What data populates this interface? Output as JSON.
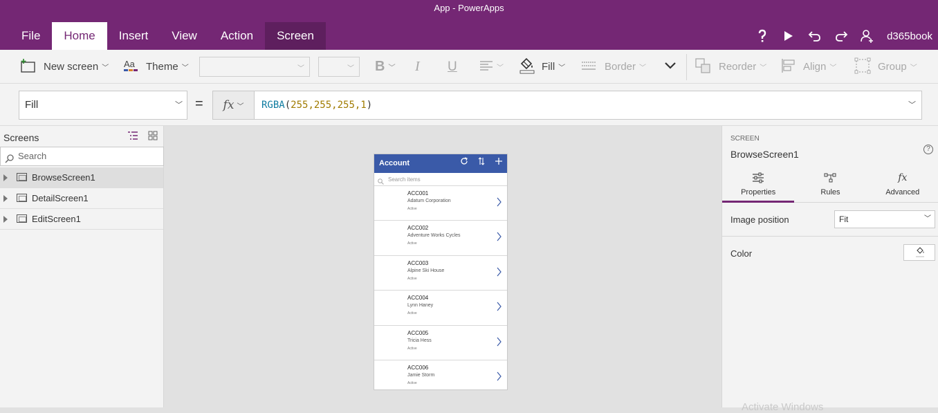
{
  "app_title": "App - PowerApps",
  "menu": {
    "tabs": [
      {
        "label": "File"
      },
      {
        "label": "Home"
      },
      {
        "label": "Insert"
      },
      {
        "label": "View"
      },
      {
        "label": "Action"
      },
      {
        "label": "Screen"
      }
    ],
    "active_tab": "Home",
    "context_tab": "Screen"
  },
  "user": "d365book",
  "top_icons": [
    "help-icon",
    "play-icon",
    "undo-icon",
    "redo-icon",
    "user-icon"
  ],
  "ribbon": {
    "new_screen": "New screen",
    "theme": "Theme",
    "font_value": "",
    "size_value": "",
    "bold": "B",
    "italic": "I",
    "underline": "U",
    "fill": "Fill",
    "border": "Border",
    "reorder": "Reorder",
    "align": "Align",
    "group": "Group"
  },
  "formula_bar": {
    "property": "Fill",
    "equals": "=",
    "fx": "fx",
    "formula_fn": "RGBA",
    "formula_args": "255,255,255,1"
  },
  "screens_panel": {
    "title": "Screens",
    "search_placeholder": "Search",
    "items": [
      {
        "label": "BrowseScreen1",
        "selected": true
      },
      {
        "label": "DetailScreen1",
        "selected": false
      },
      {
        "label": "EditScreen1",
        "selected": false
      }
    ]
  },
  "canvas": {
    "header_title": "Account",
    "search_placeholder": "Search items",
    "records": [
      {
        "title": "ACC001",
        "subtitle": "Adatum Corporation",
        "body": "Active"
      },
      {
        "title": "ACC002",
        "subtitle": "Adventure Works Cycles",
        "body": "Active"
      },
      {
        "title": "ACC003",
        "subtitle": "Alpine Ski House",
        "body": "Active"
      },
      {
        "title": "ACC004",
        "subtitle": "Lynn Haney",
        "body": "Active"
      },
      {
        "title": "ACC005",
        "subtitle": "Tricia Hess",
        "body": "Active"
      },
      {
        "title": "ACC006",
        "subtitle": "Jamie Storm",
        "body": "Active"
      }
    ]
  },
  "properties_panel": {
    "caption": "SCREEN",
    "name": "BrowseScreen1",
    "help": "?",
    "tabs": [
      {
        "label": "Properties"
      },
      {
        "label": "Rules"
      },
      {
        "label": "Advanced"
      }
    ],
    "active_tab": "Properties",
    "image_position_label": "Image position",
    "image_position_value": "Fit",
    "color_label": "Color"
  },
  "watermark": "Activate Windows",
  "colors": {
    "brand": "#742774",
    "canvas_header": "#3a5aa8",
    "formula_function": "#0e7ba0",
    "formula_number": "#a07b00"
  }
}
